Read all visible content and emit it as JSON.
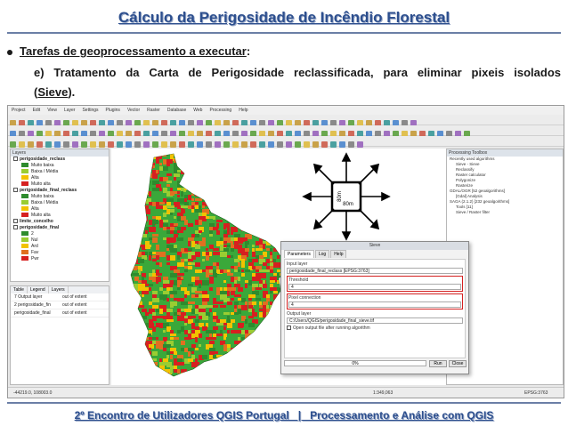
{
  "slide": {
    "title": "Cálculo da Perigosidade de Incêndio Florestal",
    "bullet": "Tarefas de geoprocessamento a executar",
    "bullet_suffix": ":",
    "sub_text": "e) Tratamento da Carta de Perigosidade reclassificada, para eliminar pixeis isolados",
    "sub_open": "(",
    "sub_link": "Sieve",
    "sub_close": ").",
    "footer": "2º Encontro de Utilizadores QGIS Portugal   |   Processamento e Análise com QGIS"
  },
  "qgis": {
    "menu": [
      "Project",
      "Edit",
      "View",
      "Layer",
      "Settings",
      "Plugins",
      "Vector",
      "Raster",
      "Database",
      "Web",
      "Processing",
      "Help"
    ],
    "layers_panel_title": "Layers",
    "layer_groups": [
      {
        "name": "perigosidade_reclass",
        "classes": [
          {
            "label": "Muito baixa",
            "color": "#2e8b2e"
          },
          {
            "label": "Baixa / Média",
            "color": "#9acd32"
          },
          {
            "label": "Alta",
            "color": "#f2c200"
          },
          {
            "label": "Muito alta",
            "color": "#d62020"
          }
        ]
      },
      {
        "name": "perigosidade_final_reclass",
        "classes": [
          {
            "label": "Muito baixa",
            "color": "#2e8b2e"
          },
          {
            "label": "Baixa / Média",
            "color": "#9acd32"
          },
          {
            "label": "Alta",
            "color": "#f2c200"
          },
          {
            "label": "Muito alta",
            "color": "#d62020"
          }
        ]
      },
      {
        "name": "limite_concelho",
        "classes": []
      },
      {
        "name": "perigosidade_final",
        "classes": [
          {
            "label": "2",
            "color": "#2e8b2e"
          },
          {
            "label": "Nul",
            "color": "#9acd32"
          },
          {
            "label": "Ard",
            "color": "#f2c200"
          },
          {
            "label": "Fav",
            "color": "#e07020"
          },
          {
            "label": "Pwr",
            "color": "#d62020"
          }
        ]
      }
    ],
    "order_tabs": [
      "Table",
      "Legend",
      "Layers"
    ],
    "order_rows": [
      {
        "name": "7 Output layer",
        "value": "out of extent"
      },
      {
        "name": "2 perigosidade_fin",
        "value": "out of extent"
      },
      {
        "name": "perigosidade_final",
        "value": "out of extent"
      }
    ],
    "processing_title": "Processing Toolbox",
    "processing_items": [
      "Recently used algorithms",
      "Sieve - Sieve",
      "Reclassify",
      "Raster calculator",
      "Polygonize",
      "Rasterize",
      "GDAL/OGR [52 geoalgorithms]",
      "[Gdal] Analysis",
      "SAGA (2.1.2) [232 geoalgorithms]",
      "Tools [11]",
      "Sieve / Raster filter"
    ],
    "status_coords": "-44219.0, 108003.0",
    "status_scale": "1:349,063",
    "status_epsg": "EPSG:3763"
  },
  "dialog": {
    "title": "Sieve",
    "tabs": [
      "Parameters",
      "Log",
      "Help"
    ],
    "input_label": "Input layer",
    "input_value": "perigosidade_final_reclass [EPSG:3763]",
    "threshold_label": "Threshold",
    "threshold_value": "4",
    "connection_label": "Pixel connection",
    "connection_value": "4",
    "output_label": "Output layer",
    "output_value": "C:/Users/QGIS/perigosidade_final_sieve.tif",
    "open_output_label": "Open output file after running algorithm",
    "progress": "0%",
    "run_button": "Run",
    "close_button": "Close"
  },
  "diagram": {
    "size_label_vertical": "80m",
    "size_label_horizontal": "80m"
  }
}
